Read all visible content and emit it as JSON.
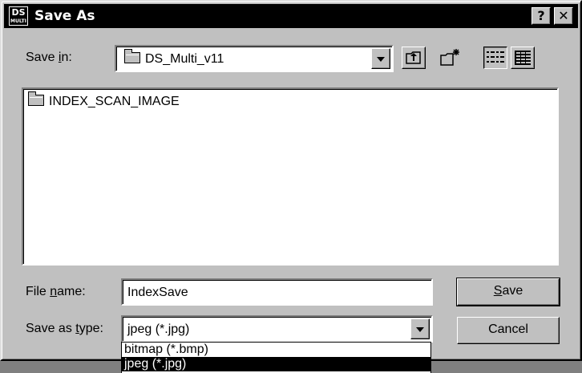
{
  "window": {
    "title": "Save As",
    "app_icon_top": "DS",
    "app_icon_bottom": "MULTI",
    "help_button": "?",
    "close_button": "✕"
  },
  "save_in": {
    "label_pre": "Save ",
    "label_access": "i",
    "label_post": "n:",
    "value": "DS_Multi_v11",
    "folder_icon": "folder-icon"
  },
  "toolbar": {
    "up_icon": "up-one-level-icon",
    "new_folder_icon": "new-folder-icon",
    "list_view_icon": "list-view-icon",
    "details_view_icon": "details-view-icon"
  },
  "files": [
    {
      "name": "INDEX_SCAN_IMAGE",
      "icon": "folder-icon"
    }
  ],
  "file_name": {
    "label_pre": "File ",
    "label_access": "n",
    "label_post": "ame:",
    "value": "IndexSave"
  },
  "save_as_type": {
    "label_pre": "Save as ",
    "label_access": "t",
    "label_post": "ype:",
    "value": "jpeg (*.jpg)",
    "options": [
      "bitmap (*.bmp)",
      "jpeg (*.jpg)"
    ],
    "selected_index": 1
  },
  "buttons": {
    "save_access": "S",
    "save_rest": "ave",
    "cancel": "Cancel"
  }
}
